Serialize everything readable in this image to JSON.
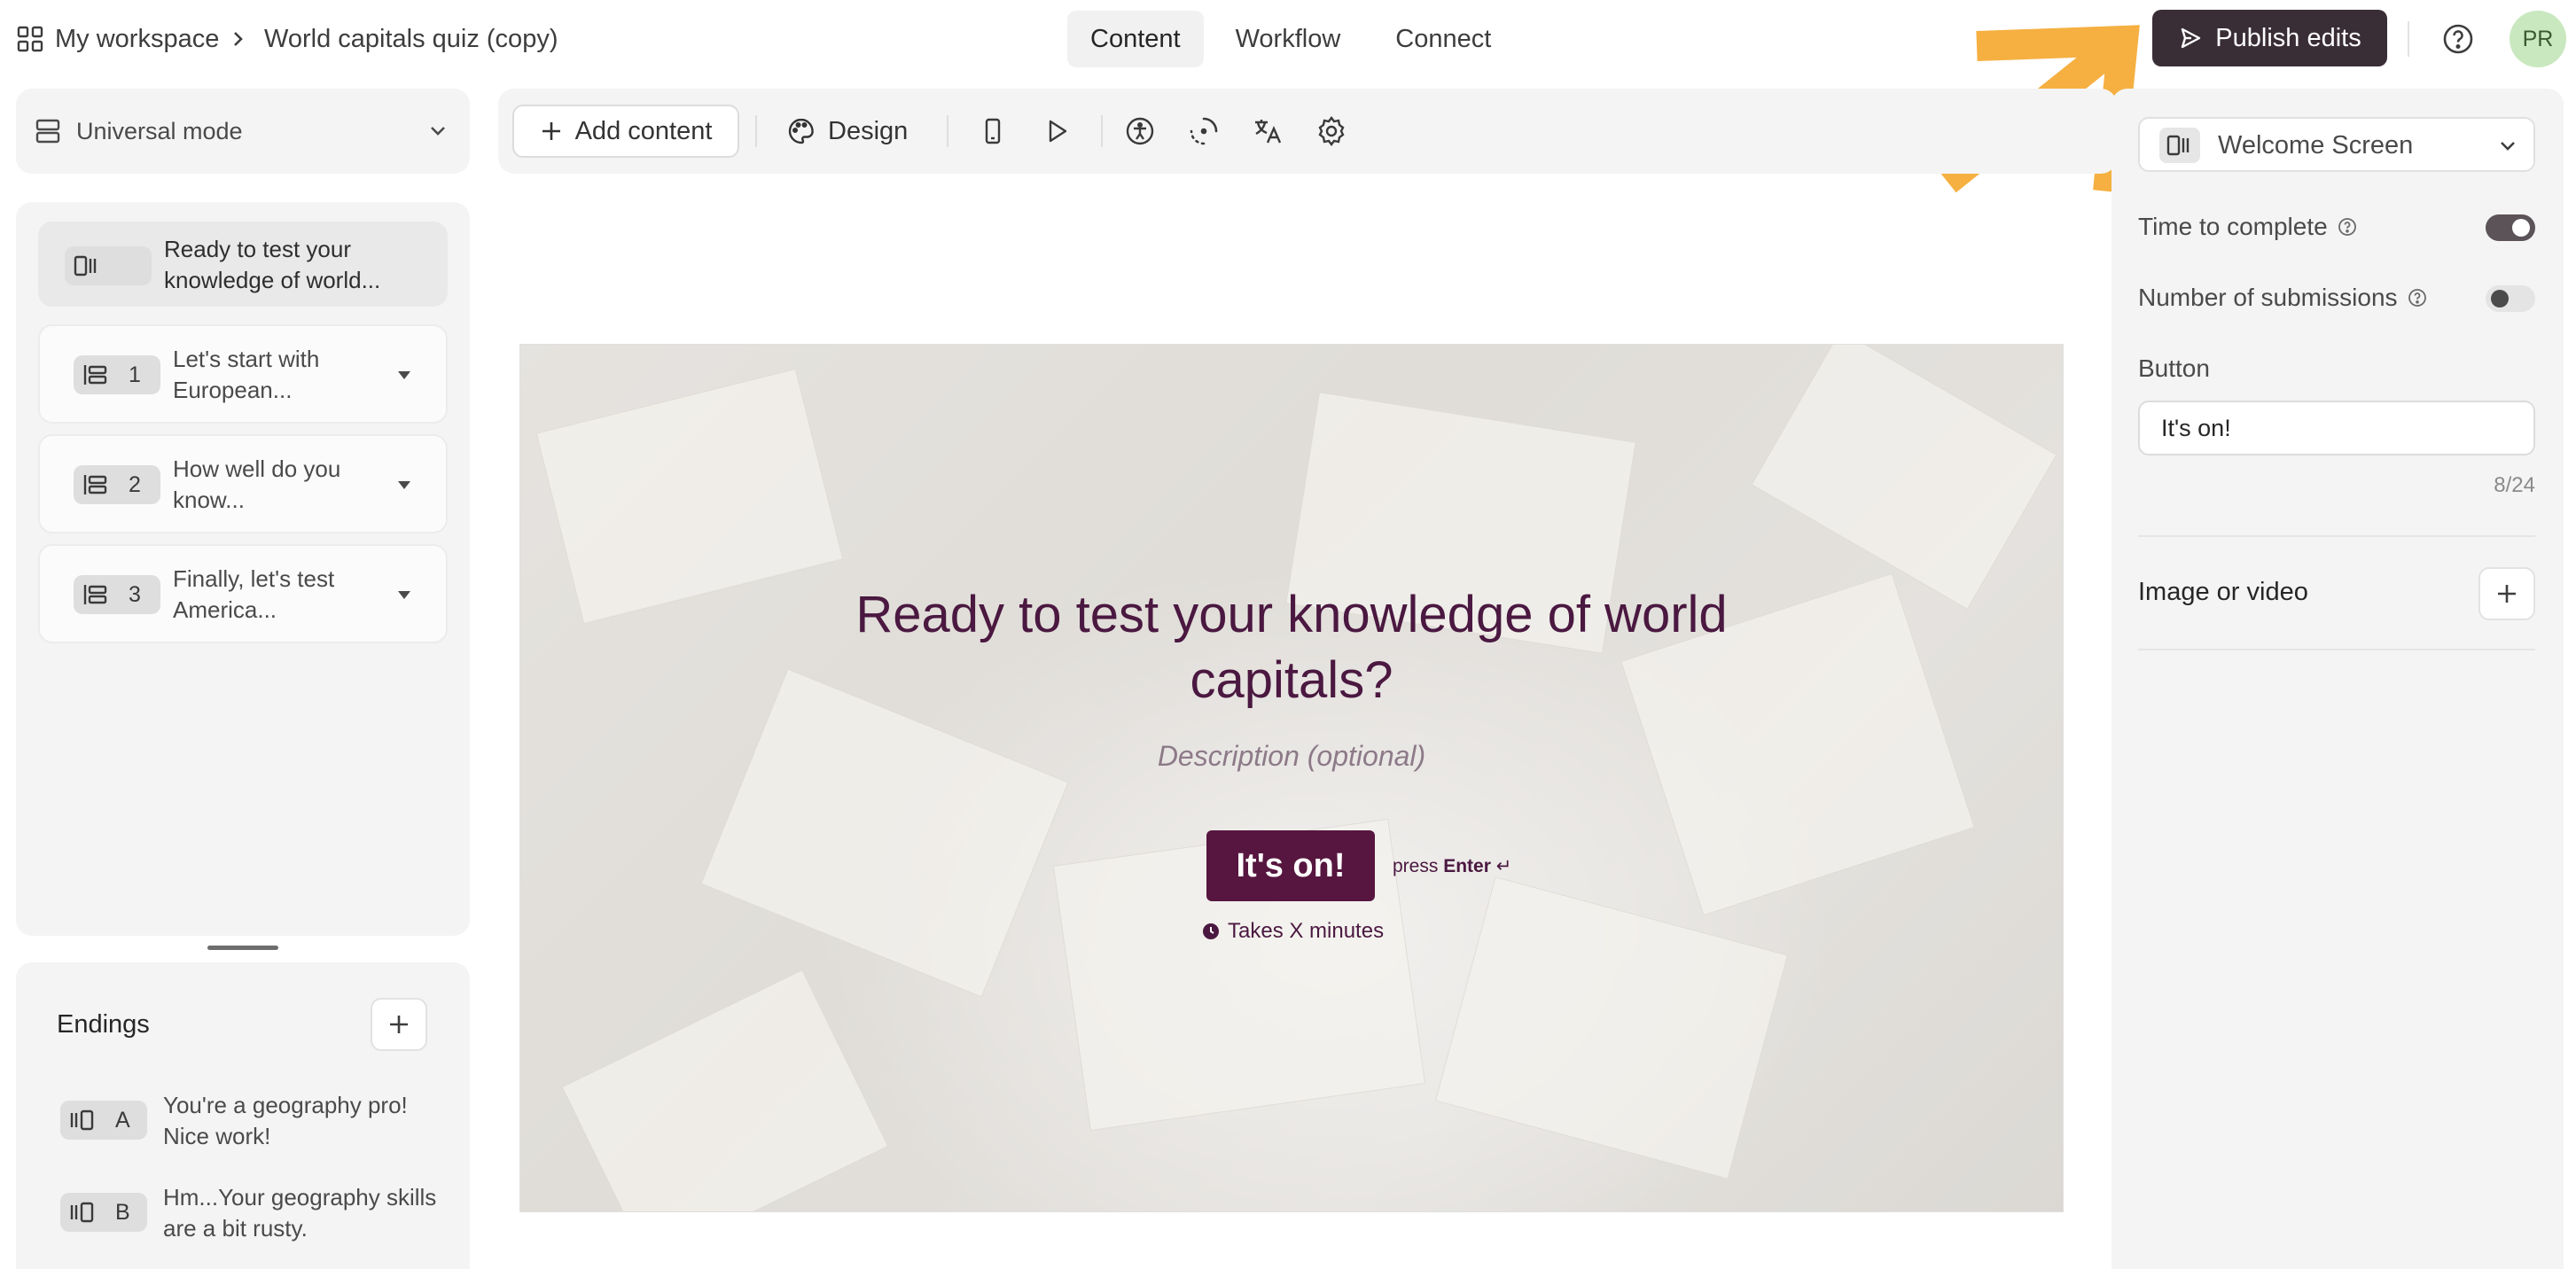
{
  "breadcrumb": {
    "workspace": "My workspace",
    "form": "World capitals quiz (copy)"
  },
  "tabs": [
    {
      "label": "Content"
    },
    {
      "label": "Workflow"
    },
    {
      "label": "Connect"
    }
  ],
  "publish": {
    "label": "Publish edits"
  },
  "avatar": {
    "initials": "PR"
  },
  "mode": {
    "label": "Universal mode"
  },
  "questions": [
    {
      "number": "",
      "text": "Ready to test your knowledge of world..."
    },
    {
      "number": "1",
      "text": "Let's start with European..."
    },
    {
      "number": "2",
      "text": "How well do you know..."
    },
    {
      "number": "3",
      "text": "Finally, let's test America..."
    }
  ],
  "endings": {
    "title": "Endings",
    "items": [
      {
        "letter": "A",
        "text": "You're a geography pro! Nice work!"
      },
      {
        "letter": "B",
        "text": "Hm...Your geography skills are a bit rusty."
      }
    ]
  },
  "toolbar": {
    "add_content": "Add content",
    "design": "Design"
  },
  "preview": {
    "title": "Ready to test your knowledge of world capitals?",
    "description": "Description (optional)",
    "button": "It's on!",
    "press": "press",
    "enter": "Enter",
    "enter_glyph": "↵",
    "takes": "Takes X minutes"
  },
  "settings": {
    "screen_type": "Welcome Screen",
    "time_to_complete": {
      "label": "Time to complete",
      "enabled": true
    },
    "number_of_submissions": {
      "label": "Number of submissions",
      "enabled": false
    },
    "button_label": "Button",
    "button_value": "It's on!",
    "char_count": "8/24",
    "media_label": "Image or video"
  },
  "colors": {
    "publish_bg": "#3a2e36",
    "brand_button": "#56163f",
    "preview_text": "#4a1840",
    "annotation_arrow": "#f5b041",
    "avatar_bg": "#c9e8bf"
  }
}
